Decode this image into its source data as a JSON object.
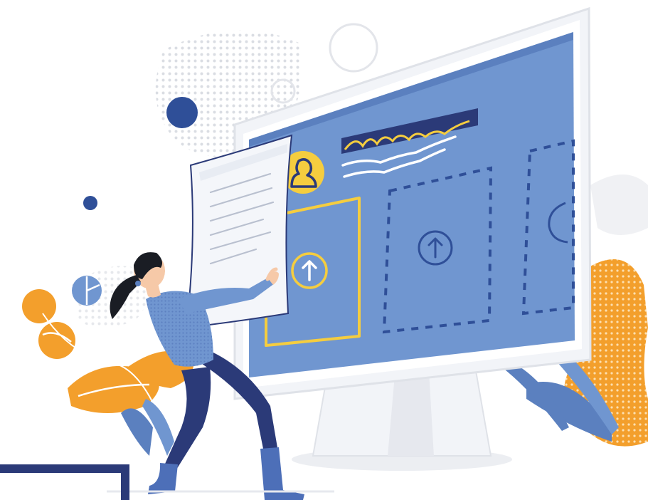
{
  "illustration": {
    "subject": "file-upload-illustration",
    "colors": {
      "screen_blue": "#7096d0",
      "screen_blue_dark": "#5b80bf",
      "navy": "#2b3a78",
      "dark_blue": "#3154a0",
      "yellow": "#f5cd3f",
      "orange": "#f39f2c",
      "white": "#ffffff",
      "frame_gray": "#f2f4f8",
      "shadow_gray": "#e6e8ee",
      "skin": "#f6c9a8",
      "hair": "#1a1d24",
      "shirt": "#7096d0",
      "pants": "#2b3a78",
      "leaf_blue": "#5b80bf"
    },
    "icons": [
      "upload-arrow-icon",
      "user-avatar-icon",
      "document-icon"
    ]
  }
}
